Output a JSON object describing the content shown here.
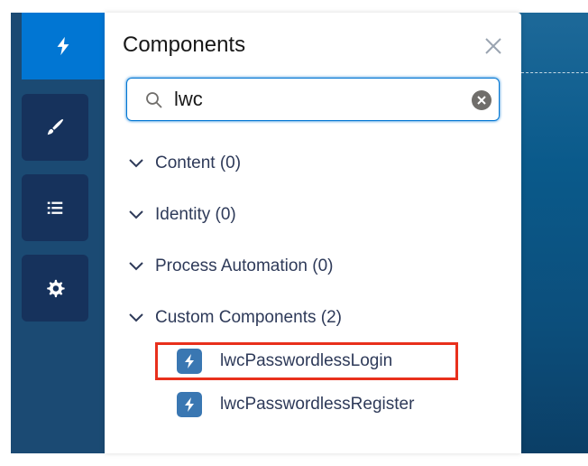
{
  "panel": {
    "title": "Components",
    "search": {
      "value": "lwc",
      "placeholder": ""
    }
  },
  "rail": {
    "items": [
      {
        "name": "components",
        "icon": "lightning-icon",
        "active": true
      },
      {
        "name": "theme",
        "icon": "paintbrush-icon",
        "active": false
      },
      {
        "name": "pages",
        "icon": "list-icon",
        "active": false
      },
      {
        "name": "settings",
        "icon": "gear-icon",
        "active": false
      }
    ]
  },
  "sections": [
    {
      "label": "Content (0)"
    },
    {
      "label": "Identity (0)"
    },
    {
      "label": "Process Automation (0)"
    },
    {
      "label": "Custom Components (2)"
    }
  ],
  "components": [
    {
      "label": "lwcPasswordlessLogin",
      "highlighted": true
    },
    {
      "label": "lwcPasswordlessRegister",
      "highlighted": false
    }
  ],
  "colors": {
    "accent": "#0176d3",
    "rail_bg": "#16325c",
    "highlight": "#e8301c",
    "component_icon": "#3a77b2"
  }
}
